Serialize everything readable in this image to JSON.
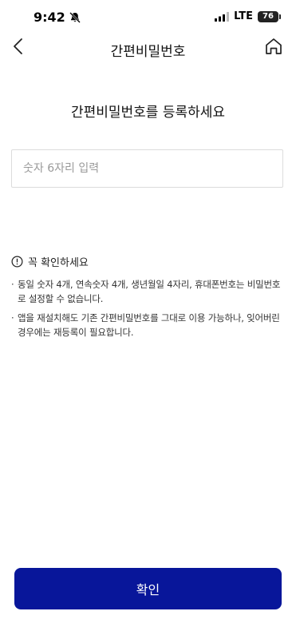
{
  "status_bar": {
    "time": "9:42",
    "network": "LTE",
    "battery": "76"
  },
  "nav": {
    "title": "간편비밀번호"
  },
  "heading": "간편비밀번호를 등록하세요",
  "pin_input": {
    "placeholder": "숫자 6자리 입력",
    "value": ""
  },
  "notice": {
    "title": "꼭 확인하세요",
    "items": [
      "동일 숫자 4개, 연속숫자 4개, 생년월일 4자리, 휴대폰번호는 비밀번호로 설정할 수 없습니다.",
      "앱을 재설치해도 기존 간편비밀번호를 그대로 이용 가능하나, 잊어버린 경우에는 재등록이 필요합니다."
    ]
  },
  "confirm_button": {
    "label": "확인"
  },
  "colors": {
    "primary": "#08169a",
    "border": "#dcdcdc"
  }
}
